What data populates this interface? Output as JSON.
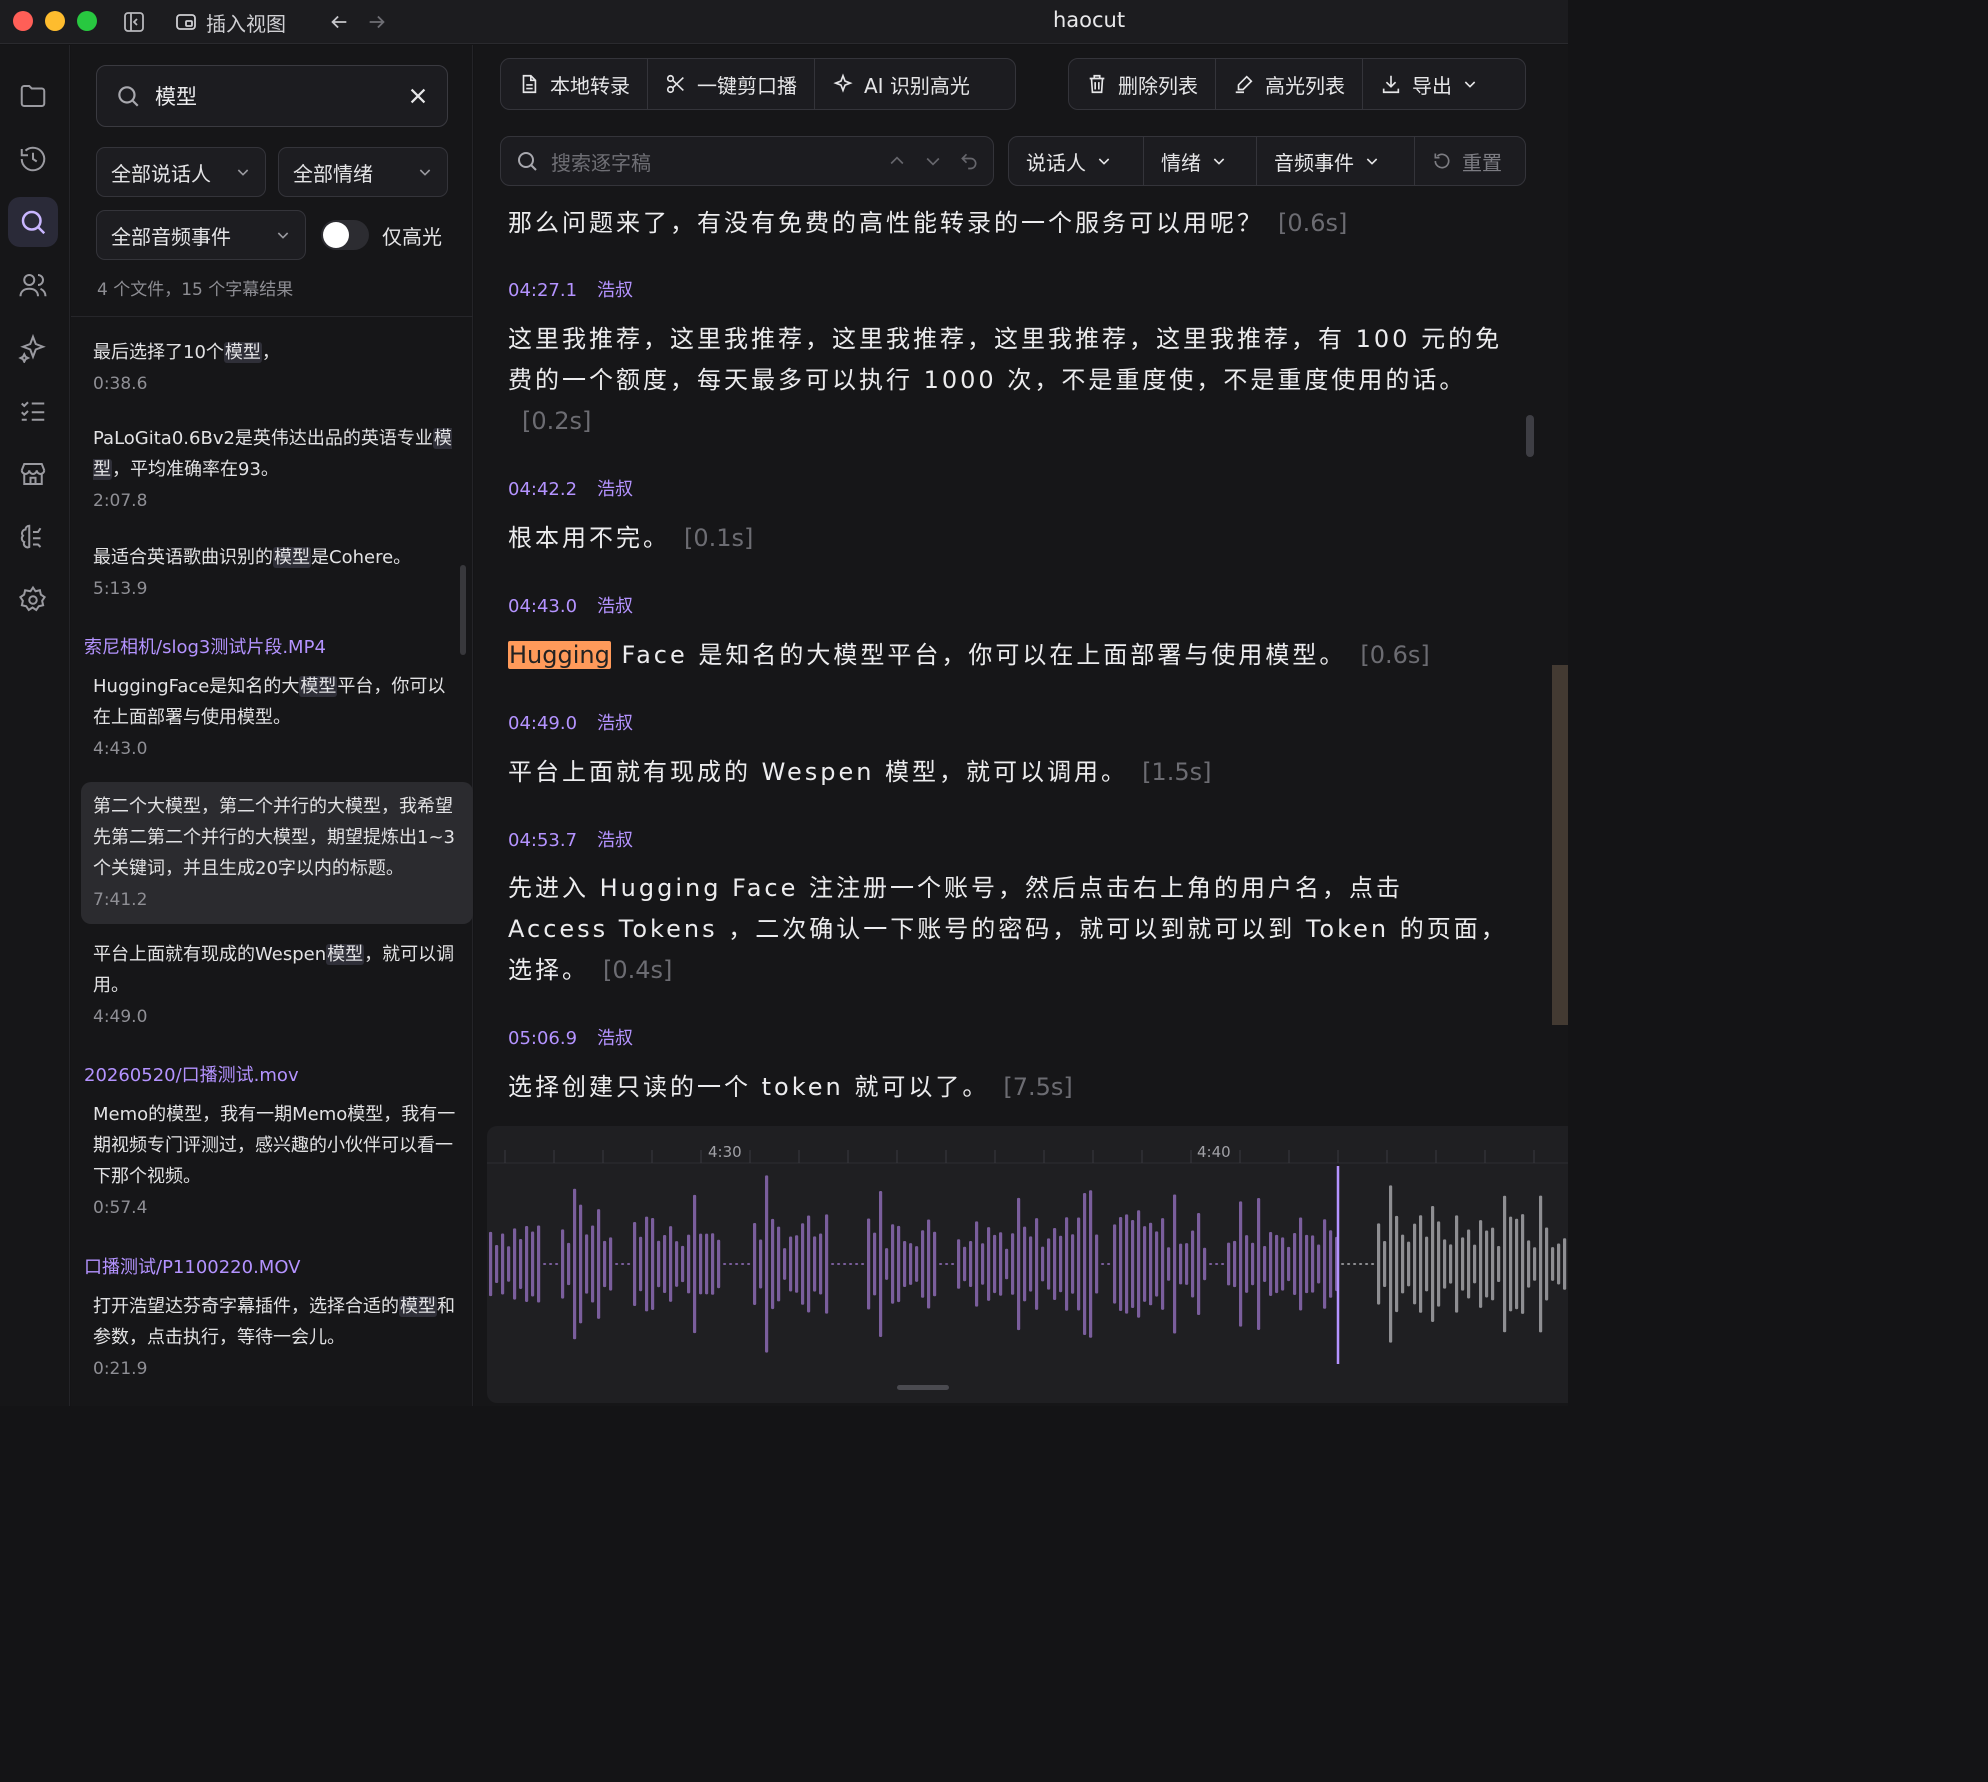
{
  "window": {
    "title": "haocut",
    "insert_view_label": "插入视图"
  },
  "search": {
    "query": "模型",
    "speaker_filter": "全部说话人",
    "emotion_filter": "全部情绪",
    "audio_event_filter": "全部音频事件",
    "highlight_only_label": "仅高光",
    "highlight_only": false,
    "summary": "4 个文件，15 个字幕结果"
  },
  "results": [
    {
      "pre": "最后选择了10个",
      "hit": "模型",
      "post": "，",
      "time": "0:38.6"
    },
    {
      "pre": "PaLoGita0.6Bv2是英伟达出品的英语专业",
      "hit": "模型",
      "post": "，平均准确率在93。",
      "time": "2:07.8"
    },
    {
      "pre": "最适合英语歌曲识别的",
      "hit": "模型",
      "post": "是Cohere。",
      "time": "5:13.9"
    },
    {
      "file": "索尼相机/slog3测试片段.MP4"
    },
    {
      "pre": "HuggingFace是知名的大",
      "hit": "模型",
      "post": "平台，你可以在上面部署与使用模型。",
      "time": "4:43.0"
    },
    {
      "text": "第二个大模型，第二个并行的大模型，我希望先第二第二个并行的大模型，期望提炼出1~3个关键词，并且生成20字以内的标题。",
      "time": "7:41.2",
      "selected": true
    },
    {
      "pre": "平台上面就有现成的Wespen",
      "hit": "模型",
      "post": "，就可以调用。",
      "time": "4:49.0"
    },
    {
      "file": "20260520/口播测试.mov"
    },
    {
      "text": "Memo的模型，我有一期Memo模型，我有一期视频专门评测过，感兴趣的小伙伴可以看一下那个视频。",
      "time": "0:57.4"
    },
    {
      "file": "口播测试/P1100220.MOV"
    },
    {
      "pre": "打开浩望达芬奇字幕插件，选择合适的",
      "hit": "模型",
      "post": "和参数，点击执行，等待一会儿。",
      "time": "0:21.9"
    }
  ],
  "toolbar": {
    "local_transcribe": "本地转录",
    "one_click_cut": "一键剪口播",
    "ai_highlight": "AI 识别高光",
    "delete_list": "删除列表",
    "highlight_list": "高光列表",
    "export": "导出"
  },
  "subtitle_search": {
    "placeholder": "搜索逐字稿",
    "speaker_label": "说话人",
    "emotion_label": "情绪",
    "audio_event_label": "音频事件",
    "reset_label": "重置"
  },
  "transcript": [
    {
      "text": "那么问题来了，有没有免费的高性能转录的一个服务可以用呢？",
      "dur": "[0.6s]"
    },
    {
      "time": "04:27.1",
      "speaker": "浩叔",
      "text": "这里我推荐，这里我推荐，这里我推荐，这里我推荐，这里我推荐，有 100 元的免费的一个额度，每天最多可以执行 1000 次，不是重度使，不是重度使用的话。",
      "dur": "[0.2s]"
    },
    {
      "time": "04:42.2",
      "speaker": "浩叔",
      "text": "根本用不完。",
      "dur": "[0.1s]"
    },
    {
      "time": "04:43.0",
      "speaker": "浩叔",
      "mark": "Hugging",
      "text": " Face 是知名的大模型平台，你可以在上面部署与使用模型。",
      "dur": "[0.6s]"
    },
    {
      "time": "04:49.0",
      "speaker": "浩叔",
      "text": "平台上面就有现成的 Wespen 模型，就可以调用。",
      "dur": "[1.5s]"
    },
    {
      "time": "04:53.7",
      "speaker": "浩叔",
      "text": "先进入 Hugging Face 注注册一个账号，然后点击右上角的用户名，点击 Access Tokens ，二次确认一下账号的密码，就可以到就可以到 Token 的页面，选择。",
      "dur": "[0.4s]"
    },
    {
      "time": "05:06.9",
      "speaker": "浩叔",
      "text": "选择创建只读的一个 token 就可以了。",
      "dur": "[7.5s]"
    }
  ],
  "timeline": {
    "tick_labels": [
      "4:30",
      "4:40"
    ],
    "playhead_position": 0.787,
    "colors": {
      "played": "#7a5e9c",
      "unplayed": "#8e8e92",
      "playhead": "#b493ff"
    }
  },
  "colors": {
    "accent": "#b493ff",
    "highlight": "#ff9a5a"
  }
}
